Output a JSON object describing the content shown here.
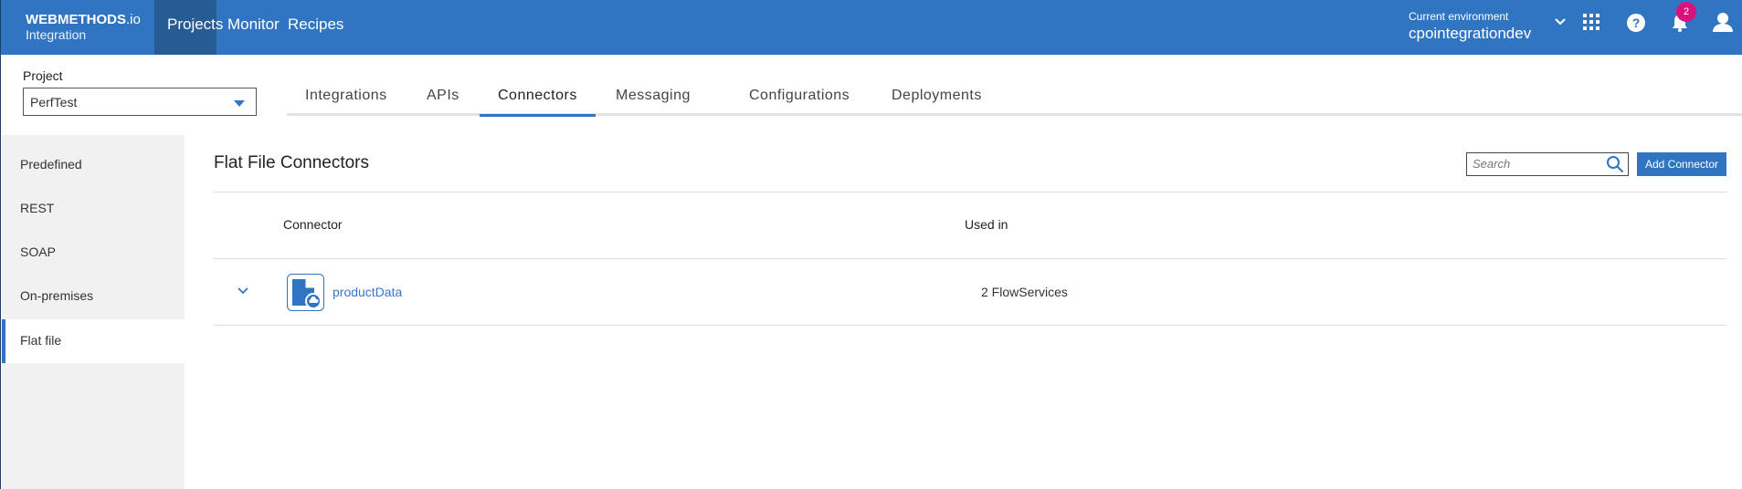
{
  "header": {
    "logo_brand": "WEBMETHODS",
    "logo_suffix": ".io",
    "logo_sub": "Integration",
    "nav": [
      "Projects",
      "Monitor",
      "Recipes"
    ],
    "env_label": "Current environment",
    "env_value": "cpointegrationdev",
    "notification_count": "2"
  },
  "project": {
    "label": "Project",
    "value": "PerfTest"
  },
  "tabs": [
    "Integrations",
    "APIs",
    "Connectors",
    "Messaging",
    "Configurations",
    "Deployments"
  ],
  "sidebar": [
    "Predefined",
    "REST",
    "SOAP",
    "On-premises",
    "Flat file"
  ],
  "main": {
    "title": "Flat File Connectors",
    "search_placeholder": "Search",
    "add_label": "Add Connector",
    "columns": [
      "Connector",
      "Used in"
    ],
    "rows": [
      {
        "name": "productData",
        "used_in": "2 FlowServices"
      }
    ]
  },
  "colors": {
    "brand": "#3075c1",
    "active_nav": "#265b93",
    "badge": "#d8137b"
  }
}
